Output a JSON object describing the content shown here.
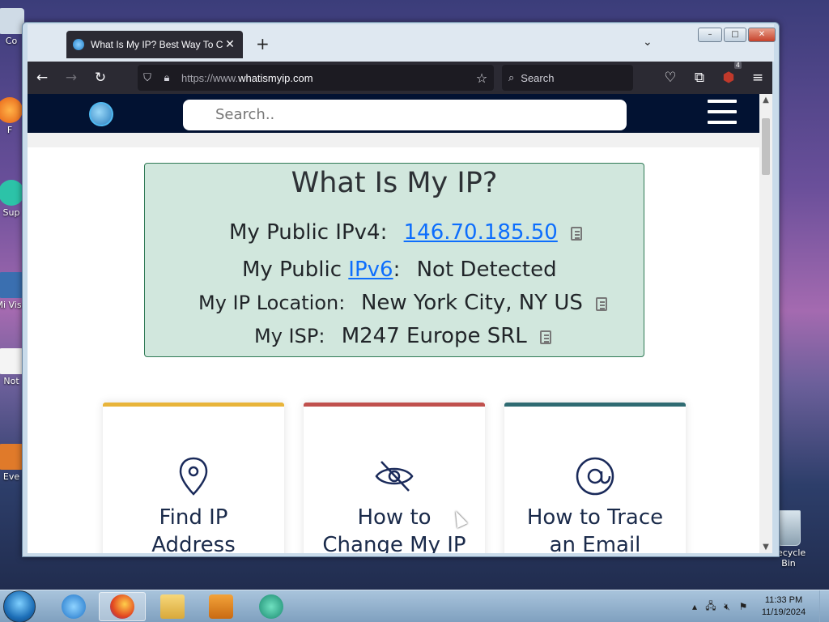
{
  "desktop": {
    "recycle_label": "Recycle Bin",
    "left_labels": [
      "Co",
      "F",
      "Sup",
      "Mi Visu",
      "Not",
      "Eve"
    ]
  },
  "browser": {
    "tab_title": "What Is My IP? Best Way To Ch",
    "tab_close": "✕",
    "new_tab": "+",
    "tab_list": "⌄",
    "url_prefix": "https://www.",
    "url_domain": "whatismyip.com",
    "search_placeholder": "Search",
    "extension_badge": "4"
  },
  "site": {
    "search_placeholder": "Search..",
    "heading": "What Is My IP?",
    "rows": {
      "ipv4_label": "My Public IPv4:",
      "ipv4_value": "146.70.185.50",
      "ipv6_label_prefix": "My Public ",
      "ipv6_link": "IPv6",
      "ipv6_label_suffix": ":",
      "ipv6_value": "Not Detected",
      "location_label": "My IP Location:",
      "location_value": "New York City, NY US",
      "isp_label": "My ISP:",
      "isp_value": "M247 Europe SRL"
    },
    "cards": [
      {
        "title_line1": "Find IP",
        "title_line2": "Address",
        "accent": "#e8b43a",
        "icon": "map-pin-icon"
      },
      {
        "title_line1": "How to",
        "title_line2": "Change My IP",
        "accent": "#c0504d",
        "icon": "eye-slash-icon"
      },
      {
        "title_line1": "How to Trace",
        "title_line2": "an Email",
        "accent": "#2f6b72",
        "icon": "at-sign-icon"
      }
    ]
  },
  "taskbar": {
    "time": "11:33 PM",
    "date": "11/19/2024"
  },
  "colors": {
    "site_nav": "#021232",
    "ip_box_bg": "#d1e7dd",
    "link": "#0d6efd",
    "browser_chrome": "#2b2a33"
  }
}
